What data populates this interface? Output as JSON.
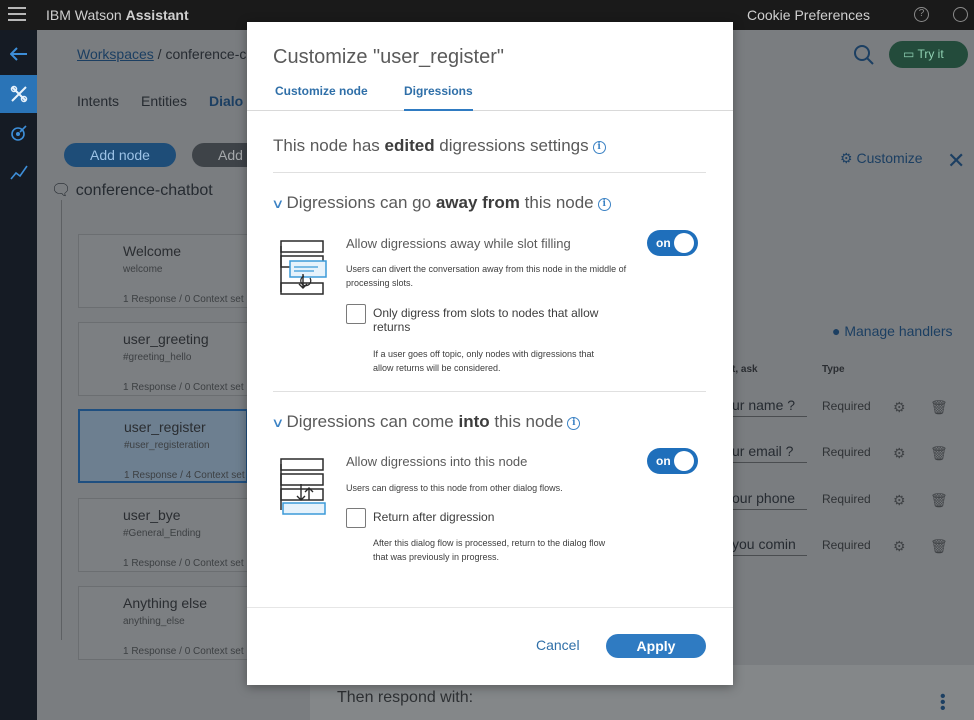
{
  "topbar": {
    "brand_prefix": "IBM Watson ",
    "brand_bold": "Assistant",
    "cookie_label": "Cookie Preferences",
    "help_glyph": "?"
  },
  "background": {
    "breadcrumb_link": "Workspaces",
    "breadcrumb_rest": " / conference-ch",
    "tabs": [
      "Intents",
      "Entities",
      "Dialo"
    ],
    "try_it": "Try it",
    "add_node": "Add node",
    "add_child": "Add",
    "tree_root": "conference-chatbot",
    "nodes": [
      {
        "title": "Welcome",
        "condition": "welcome",
        "responses": "1 Response / 0 Context set"
      },
      {
        "title": "user_greeting",
        "condition": "#greeting_hello",
        "responses": "1 Response / 0 Context set"
      },
      {
        "title": "user_register",
        "condition": "#user_registeration",
        "responses": "1 Response / 4 Context set"
      },
      {
        "title": "user_bye",
        "condition": "#General_Ending",
        "responses": "1 Response / 0 Context set"
      },
      {
        "title": "Anything else",
        "condition": "anything_else",
        "responses": "1 Response / 0 Context set"
      }
    ],
    "customize": "Customize",
    "manage_handlers": "Manage handlers",
    "col_ask": "t, ask",
    "col_type": "Type",
    "slot_rows": [
      {
        "prompt": "ur name ?",
        "type": "Required"
      },
      {
        "prompt": "ur email ?",
        "type": "Required"
      },
      {
        "prompt": "our phone",
        "type": "Required"
      },
      {
        "prompt": " you comin",
        "type": "Required"
      }
    ],
    "respond_label": "Then respond with:"
  },
  "modal": {
    "title": "Customize \"user_register\"",
    "tabs": {
      "customize_node": "Customize node",
      "digressions": "Digressions"
    },
    "status_prefix": "This node has ",
    "status_bold": "edited",
    "status_suffix": " digressions settings",
    "away": {
      "title_prefix": "Digressions can go ",
      "title_bold": "away from",
      "title_suffix": " this node",
      "option_label": "Allow digressions away while slot filling",
      "option_desc": "Users can divert the conversation away from this node in the middle of processing slots.",
      "toggle": "on",
      "checkbox_label": "Only digress from slots to nodes that allow returns",
      "checkbox_desc": "If a user goes off topic, only nodes with digressions that allow returns will be considered."
    },
    "into": {
      "title_prefix": "Digressions can come ",
      "title_bold": "into",
      "title_suffix": " this node",
      "option_label": "Allow digressions into this node",
      "option_desc": "Users can digress to this node from other dialog flows.",
      "toggle": "on",
      "checkbox_label": "Return after digression",
      "checkbox_desc": "After this dialog flow is processed, return to the dialog flow that was previously in progress."
    },
    "cancel": "Cancel",
    "apply": "Apply"
  },
  "colors": {
    "accent": "#2f7bc2",
    "toggle_on": "#1f6fbb",
    "topbar": "#1a1a1a",
    "leftnav": "#151b24"
  }
}
